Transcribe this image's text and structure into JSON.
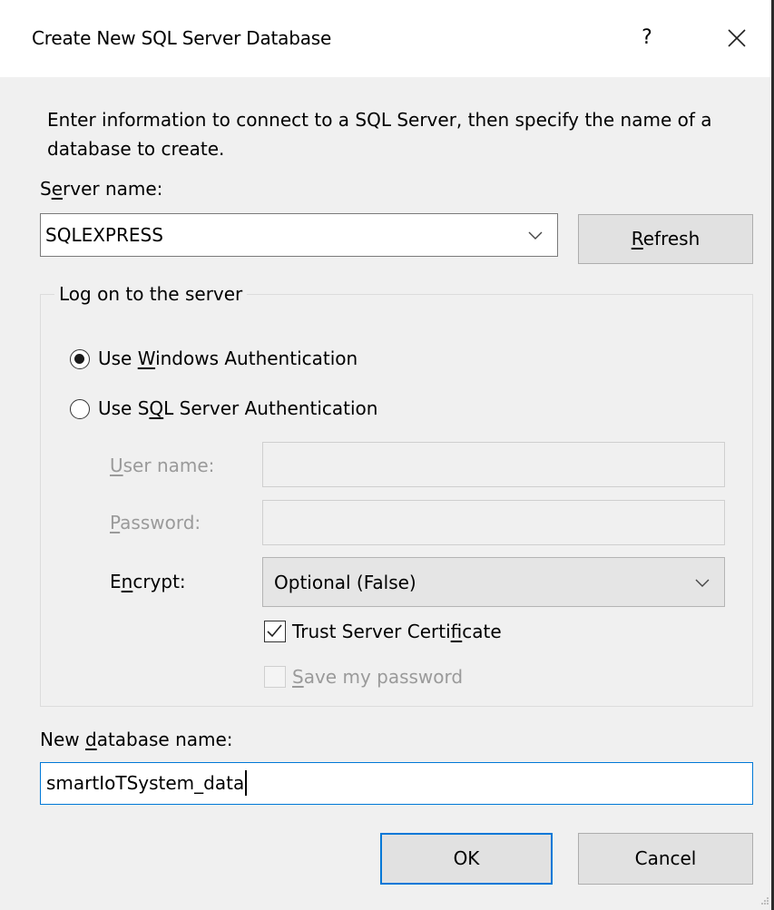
{
  "window": {
    "title": "Create New SQL Server Database",
    "help_label": "?"
  },
  "intro": "Enter information to connect to a SQL Server, then specify the name of a database to create.",
  "server": {
    "label_prefix": "S",
    "label_mnemonic": "e",
    "label_rest": "rver name:",
    "value": "SQLEXPRESS",
    "refresh_mnemonic": "R",
    "refresh_rest": "efresh"
  },
  "logon": {
    "group_title": "Log on to the server",
    "windows_auth": {
      "prefix": "Use ",
      "mnemonic": "W",
      "rest": "indows Authentication",
      "selected": true
    },
    "sql_auth": {
      "prefix": "Use S",
      "mnemonic": "Q",
      "rest": "L Server Authentication",
      "selected": false
    },
    "username": {
      "mnemonic": "U",
      "rest": "ser name:",
      "value": ""
    },
    "password": {
      "mnemonic": "P",
      "rest": "assword:",
      "value": ""
    },
    "encrypt": {
      "prefix": "E",
      "mnemonic": "n",
      "rest": "crypt:",
      "value": "Optional (False)"
    },
    "trust_cert": {
      "prefix": "Trust Server Certi",
      "mnemonic": "f",
      "rest": "icate",
      "checked": true
    },
    "save_password": {
      "mnemonic": "S",
      "rest": "ave my password",
      "checked": false,
      "enabled": false
    }
  },
  "new_db": {
    "label_prefix": "New ",
    "label_mnemonic": "d",
    "label_rest": "atabase name:",
    "value": "smartIoTSystem_data"
  },
  "buttons": {
    "ok": "OK",
    "cancel": "Cancel"
  },
  "icons": {
    "close": "close-icon",
    "dropdown": "chevron-down-icon",
    "check": "checkmark-icon"
  },
  "colors": {
    "accent": "#0078d7",
    "dialog_bg": "#f0f0f0"
  }
}
